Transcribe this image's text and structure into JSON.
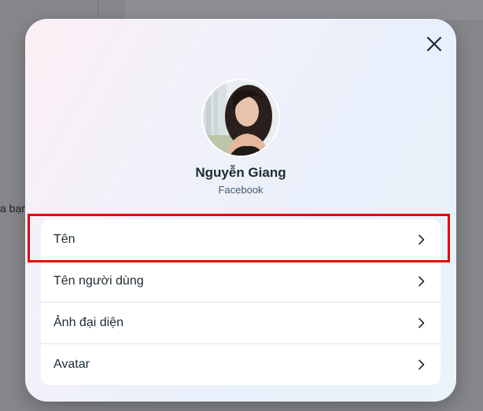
{
  "background": {
    "partial_text": "a bạn"
  },
  "profile": {
    "name": "Nguyễn Giang",
    "source": "Facebook"
  },
  "menu": {
    "items": [
      {
        "label": "Tên"
      },
      {
        "label": "Tên người dùng"
      },
      {
        "label": "Ảnh đại diện"
      },
      {
        "label": "Avatar"
      }
    ]
  },
  "colors": {
    "highlight": "#e40000",
    "text_primary": "#1c2b33",
    "text_secondary": "#465a69"
  },
  "icons": {
    "close": "close-icon",
    "chevron": "chevron-right-icon"
  }
}
